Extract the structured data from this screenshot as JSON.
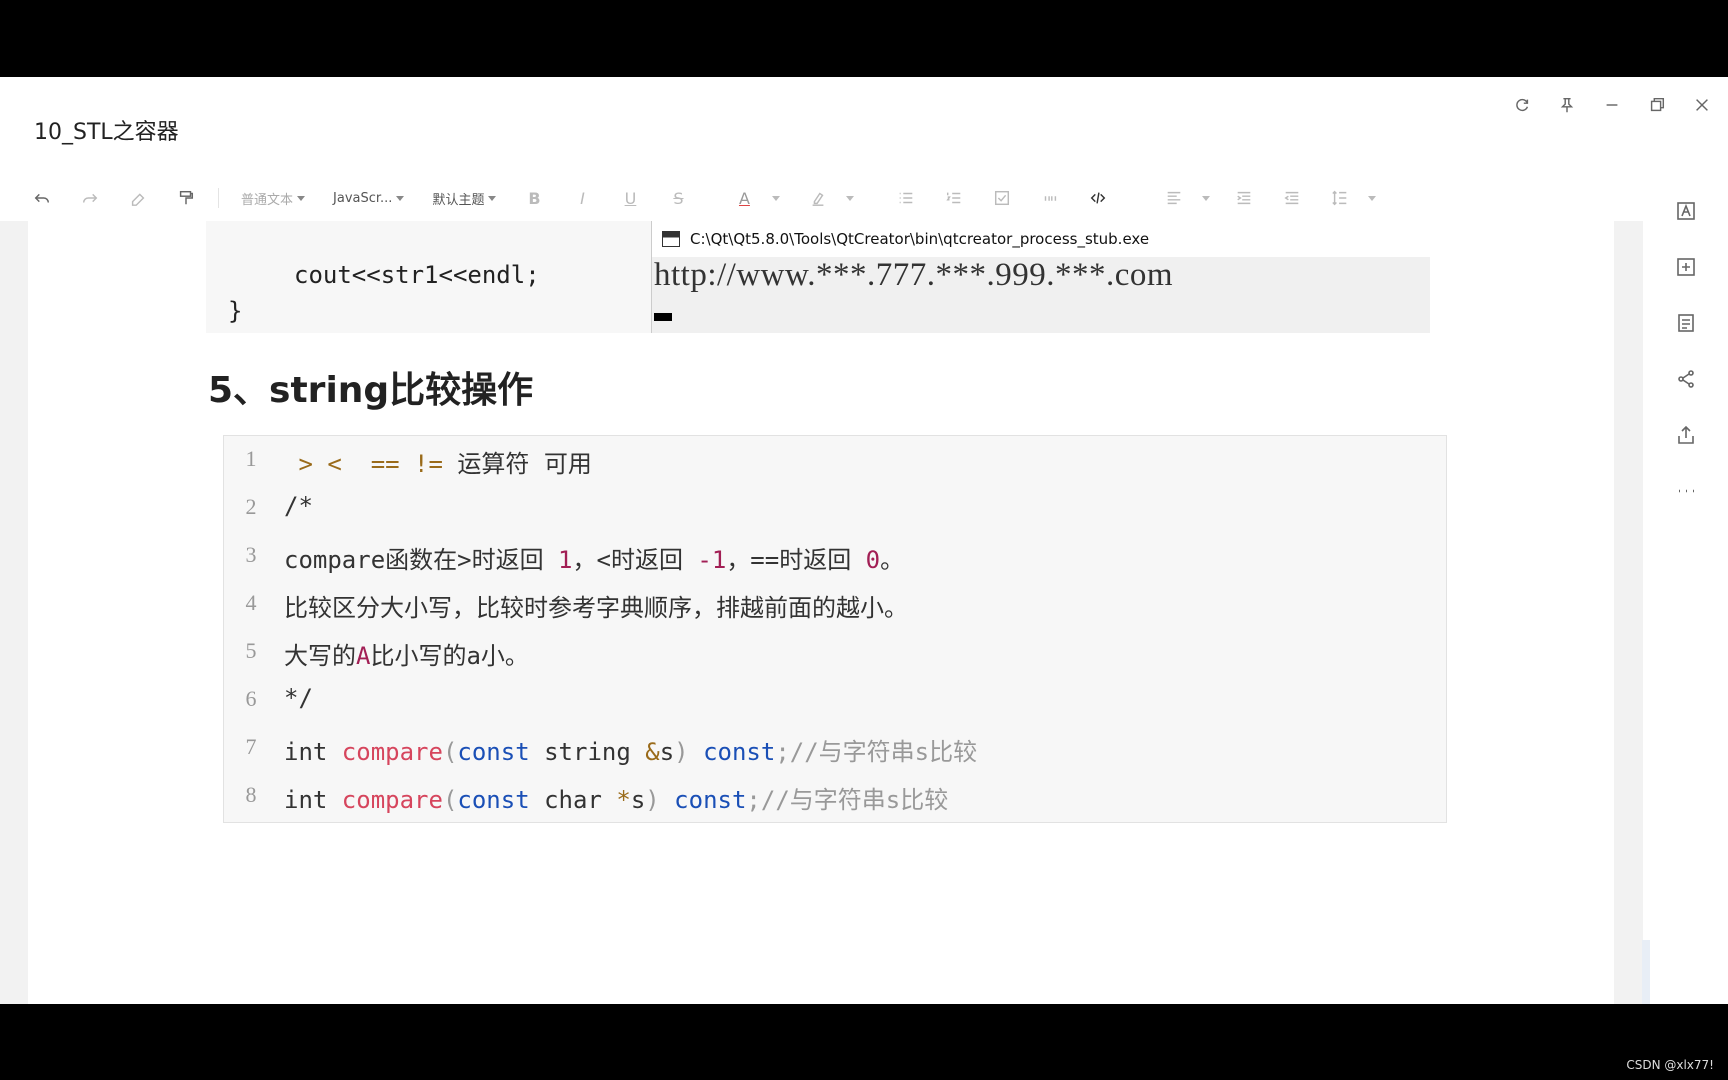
{
  "window": {
    "title": "10_STL之容器",
    "controls": [
      "refresh-icon",
      "pin-icon",
      "minimize-icon",
      "restore-icon",
      "close-icon"
    ]
  },
  "toolbar": {
    "paragraph_style": "普通文本",
    "code_language": "JavaScr...",
    "theme": "默认主题",
    "buttons": [
      "undo-icon",
      "redo-icon",
      "eraser-icon",
      "format-painter-icon",
      "bold-icon",
      "italic-icon",
      "underline-icon",
      "strikethrough-icon",
      "font-color-icon",
      "highlight-icon",
      "bullet-list-icon",
      "numbered-list-icon",
      "checklist-icon",
      "quote-icon",
      "code-icon",
      "align-icon",
      "indent-icon",
      "outdent-icon",
      "line-height-icon"
    ],
    "bold": "B",
    "italic": "I",
    "underline": "U",
    "strike": "S",
    "font_color": "A"
  },
  "sidebar": {
    "items": [
      "text-style-icon",
      "insert-icon",
      "outline-icon",
      "share-icon",
      "export-icon",
      "more-icon"
    ]
  },
  "top_code": {
    "lines": [
      "}",
      "cout<<str1<<endl;",
      "}"
    ]
  },
  "console": {
    "title": "C:\\Qt\\Qt5.8.0\\Tools\\QtCreator\\bin\\qtcreator_process_stub.exe",
    "output": "http://www.***.777.***.999.***.com"
  },
  "section": {
    "heading": "5、string比较操作"
  },
  "code_lines": [
    {
      "n": "1"
    },
    {
      "n": "2"
    },
    {
      "n": "3"
    },
    {
      "n": "4"
    },
    {
      "n": "5"
    },
    {
      "n": "6"
    },
    {
      "n": "7"
    },
    {
      "n": "8"
    }
  ],
  "code": {
    "l1_a": " > < ",
    "l1_b": " == != ",
    "l1_c": "运算符 可用",
    "l2": "/*",
    "l3_a": "compare函数在>时返回 ",
    "l3_b": "1",
    "l3_c": "，<时返回 ",
    "l3_d": "-1",
    "l3_e": "，==时返回 ",
    "l3_f": "0",
    "l3_g": "。",
    "l4": "比较区分大小写，比较时参考字典顺序，排越前面的越小。",
    "l5_a": "大写的",
    "l5_b": "A",
    "l5_c": "比小写的a小。",
    "l6": "*/",
    "l7_int": "int ",
    "l7_fn": "compare",
    "l7_p1": "(",
    "l7_const": "const",
    "l7_mid": " string ",
    "l7_amp": "&",
    "l7_s": "s",
    "l7_p2": ") ",
    "l7_const2": "const",
    "l7_cm": ";//与字符串s比较",
    "l8_int": "int ",
    "l8_fn": "compare",
    "l8_p1": "(",
    "l8_const": "const",
    "l8_mid": " char ",
    "l8_star": "*",
    "l8_s": "s",
    "l8_p2": ") ",
    "l8_const2": "const",
    "l8_cm": ";//与字符串s比较"
  },
  "watermark": "CSDN @xlx77!",
  "colors": {
    "keyword": "#1a4fb6",
    "function": "#d6455d",
    "number": "#a21f55",
    "comment": "#999999"
  }
}
